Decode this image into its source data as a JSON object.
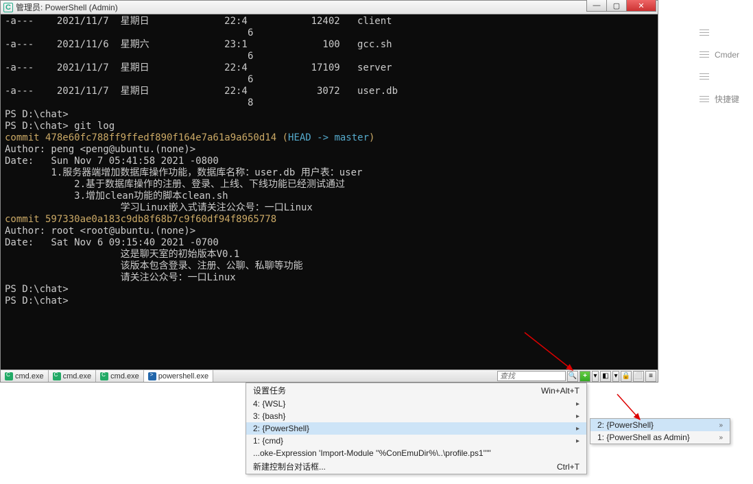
{
  "title": "管理员: PowerShell (Admin)",
  "terminal_lines": [
    {
      "t": "-a---    2021/11/7  星期日             22:4           12402   client",
      "cls": ""
    },
    {
      "t": "                                          6",
      "cls": ""
    },
    {
      "t": "-a---    2021/11/6  星期六             23:1             100   gcc.sh",
      "cls": ""
    },
    {
      "t": "                                          6",
      "cls": ""
    },
    {
      "t": "-a---    2021/11/7  星期日             22:4           17109   server",
      "cls": ""
    },
    {
      "t": "                                          6",
      "cls": ""
    },
    {
      "t": "-a---    2021/11/7  星期日             22:4            3072   user.db",
      "cls": ""
    },
    {
      "t": "                                          8",
      "cls": ""
    },
    {
      "t": "",
      "cls": ""
    },
    {
      "t": "",
      "cls": ""
    },
    {
      "t": "PS D:\\chat>",
      "cls": ""
    },
    {
      "t": "PS D:\\chat> git log",
      "cls": ""
    },
    {
      "spans": [
        {
          "t": "commit 478e60fc788ff9ffedf890f164e7a61a9a650d14 (",
          "c": "c-yellow"
        },
        {
          "t": "HEAD -> ",
          "c": "c-cyan"
        },
        {
          "t": "master",
          "c": "c-cyan"
        },
        {
          "t": ")",
          "c": "c-yellow"
        }
      ]
    },
    {
      "t": "Author: peng <peng@ubuntu.(none)>",
      "cls": ""
    },
    {
      "t": "Date:   Sun Nov 7 05:41:58 2021 -0800",
      "cls": ""
    },
    {
      "t": "",
      "cls": ""
    },
    {
      "t": "        1.服务器端增加数据库操作功能，数据库名称：user.db 用户表：user",
      "cls": ""
    },
    {
      "t": "            2.基于数据库操作的注册、登录、上线、下线功能已经测试通过",
      "cls": ""
    },
    {
      "t": "            3.增加clean功能的脚本clean.sh",
      "cls": ""
    },
    {
      "t": "                    学习Linux嵌入式请关注公众号：一口Linux",
      "cls": ""
    },
    {
      "t": "",
      "cls": ""
    },
    {
      "spans": [
        {
          "t": "commit 597330ae0a183c9db8f68b7c9f60df94f8965778",
          "c": "c-yellow"
        }
      ]
    },
    {
      "t": "Author: root <root@ubuntu.(none)>",
      "cls": ""
    },
    {
      "t": "Date:   Sat Nov 6 09:15:40 2021 -0700",
      "cls": ""
    },
    {
      "t": "",
      "cls": ""
    },
    {
      "t": "                    这是聊天室的初始版本V0.1",
      "cls": ""
    },
    {
      "t": "                    该版本包含登录、注册、公聊、私聊等功能",
      "cls": ""
    },
    {
      "t": "                    请关注公众号：一口Linux",
      "cls": ""
    },
    {
      "t": "PS D:\\chat>",
      "cls": ""
    },
    {
      "t": "PS D:\\chat>",
      "cls": ""
    }
  ],
  "tabs": [
    {
      "label": "cmd.exe",
      "icon": "cmd"
    },
    {
      "label": "cmd.exe",
      "icon": "cmd"
    },
    {
      "label": "cmd.exe",
      "icon": "cmd"
    },
    {
      "label": "powershell.exe",
      "icon": "ps",
      "active": true
    }
  ],
  "search_placeholder": "查找",
  "menu1": {
    "header": {
      "label": "设置任务",
      "shortcut": "Win+Alt+T"
    },
    "items": [
      {
        "label": "4: {WSL}",
        "sub": true
      },
      {
        "label": "3: {bash}",
        "sub": true
      },
      {
        "label": "2: {PowerShell}",
        "sub": true,
        "hl": true
      },
      {
        "label": "1: {cmd}",
        "sub": true
      },
      {
        "label": "...oke-Expression 'Import-Module ''%ConEmuDir%\\..\\profile.ps1'''\""
      },
      {
        "label": "新建控制台对话框...",
        "shortcut": "Ctrl+T"
      }
    ]
  },
  "menu2": {
    "items": [
      {
        "label": "2: {PowerShell}",
        "sub": true,
        "hl": true
      },
      {
        "label": "1: {PowerShell as Admin}",
        "sub": true
      }
    ]
  },
  "side": {
    "item1": "Cmder",
    "item2": "快捷键"
  }
}
